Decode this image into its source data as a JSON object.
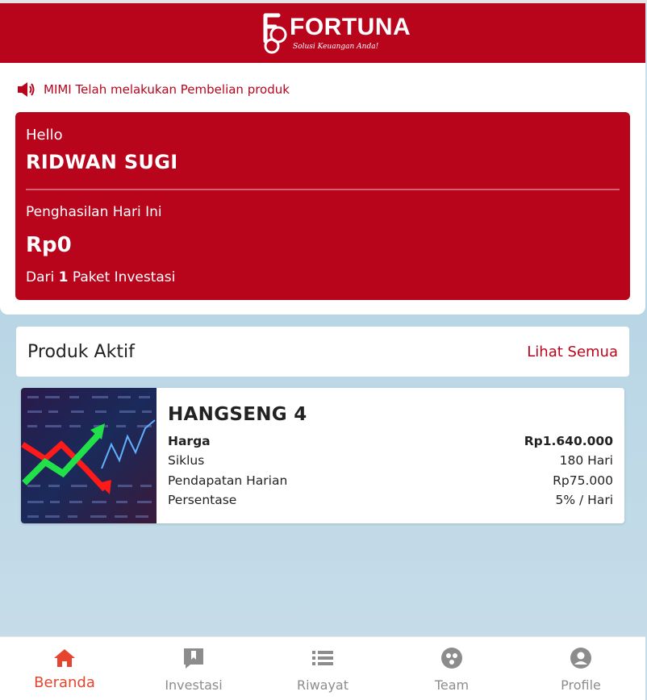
{
  "header": {
    "logo_text": "FORTUNA",
    "logo_tagline": "Solusi Keuangan Anda!"
  },
  "announcement": {
    "icon": "megaphone-icon",
    "text": "MIMI Telah melakukan Pembelian produk"
  },
  "greeting": {
    "hello": "Hello",
    "username": "RIDWAN SUGI",
    "earnings_label": "Penghasilan Hari Ini",
    "earnings_value": "Rp0",
    "from_prefix": "Dari",
    "package_count": "1",
    "from_suffix": "Paket Investasi"
  },
  "active_products": {
    "title": "Produk Aktif",
    "see_all": "Lihat Semua",
    "items": [
      {
        "name": "HANGSENG 4",
        "rows": [
          {
            "label": "Harga",
            "value": "Rp1.640.000"
          },
          {
            "label": "Siklus",
            "value": "180 Hari"
          },
          {
            "label": "Pendapatan Harian",
            "value": "Rp75.000"
          },
          {
            "label": "Persentase",
            "value": "5% / Hari"
          }
        ]
      }
    ]
  },
  "nav": {
    "items": [
      {
        "label": "Beranda",
        "icon": "home-icon",
        "active": true
      },
      {
        "label": "Investasi",
        "icon": "bookmark-icon",
        "active": false
      },
      {
        "label": "Riwayat",
        "icon": "list-icon",
        "active": false
      },
      {
        "label": "Team",
        "icon": "team-icon",
        "active": false
      },
      {
        "label": "Profile",
        "icon": "profile-icon",
        "active": false
      }
    ]
  },
  "colors": {
    "brand_red": "#b8051c",
    "active_nav": "#e5452f",
    "inactive_nav": "#8c8c8c"
  }
}
